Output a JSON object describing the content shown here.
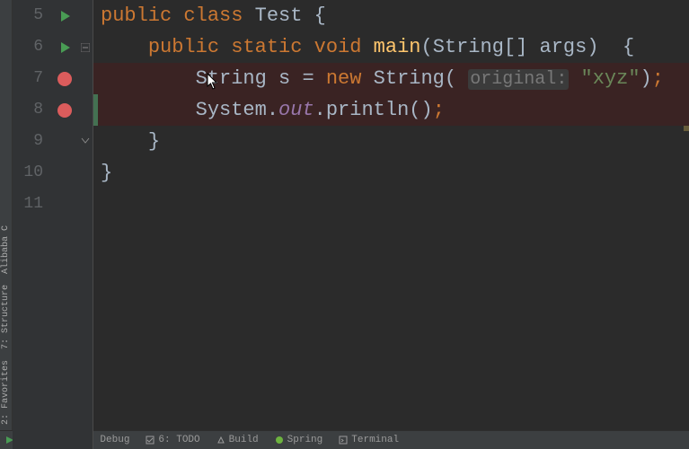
{
  "lines": [
    {
      "num": 5,
      "run": true,
      "bp": false,
      "fold": null,
      "bpBg": false,
      "changed": false
    },
    {
      "num": 6,
      "run": true,
      "bp": false,
      "fold": "minus",
      "bpBg": false,
      "changed": false
    },
    {
      "num": 7,
      "run": false,
      "bp": true,
      "fold": null,
      "bpBg": true,
      "changed": false
    },
    {
      "num": 8,
      "run": false,
      "bp": true,
      "fold": null,
      "bpBg": true,
      "changed": true
    },
    {
      "num": 9,
      "run": false,
      "bp": false,
      "fold": "up",
      "bpBg": false,
      "changed": false
    },
    {
      "num": 10,
      "run": false,
      "bp": false,
      "fold": null,
      "bpBg": false,
      "changed": false
    },
    {
      "num": 11,
      "run": false,
      "bp": false,
      "fold": null,
      "bpBg": false,
      "changed": false
    }
  ],
  "tokens": {
    "kw_public": "public",
    "kw_class": "class",
    "cls_Test": "Test",
    "brace_o": "{",
    "brace_c": "}",
    "kw_static": "static",
    "kw_void": "void",
    "m_main": "main",
    "paren_o": "(",
    "paren_c": ")",
    "t_String": "String",
    "brackets": "[]",
    "p_args": "args",
    "v_s": "s",
    "eq": "=",
    "kw_new": "new",
    "hint_original": "original:",
    "str_xyz": "\"xyz\"",
    "semi": ";",
    "t_System": "System",
    "dot": ".",
    "f_out": "out",
    "m_println": "println"
  },
  "left_tabs": {
    "structure": "7: Structure",
    "favorites": "2: Favorites",
    "alibaba": "Alibaba C"
  },
  "statusbar": {
    "run": "4: Run",
    "debug": "5: Debug",
    "todo": "6: TODO",
    "build": "Build",
    "spring": "Spring",
    "terminal": "Terminal"
  }
}
